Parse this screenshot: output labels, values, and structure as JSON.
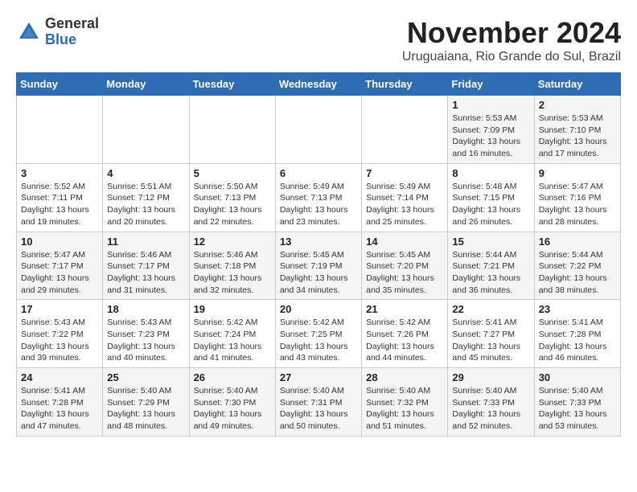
{
  "header": {
    "logo_general": "General",
    "logo_blue": "Blue",
    "month": "November 2024",
    "location": "Uruguaiana, Rio Grande do Sul, Brazil"
  },
  "weekdays": [
    "Sunday",
    "Monday",
    "Tuesday",
    "Wednesday",
    "Thursday",
    "Friday",
    "Saturday"
  ],
  "weeks": [
    [
      {
        "day": "",
        "info": ""
      },
      {
        "day": "",
        "info": ""
      },
      {
        "day": "",
        "info": ""
      },
      {
        "day": "",
        "info": ""
      },
      {
        "day": "",
        "info": ""
      },
      {
        "day": "1",
        "info": "Sunrise: 5:53 AM\nSunset: 7:09 PM\nDaylight: 13 hours and 16 minutes."
      },
      {
        "day": "2",
        "info": "Sunrise: 5:53 AM\nSunset: 7:10 PM\nDaylight: 13 hours and 17 minutes."
      }
    ],
    [
      {
        "day": "3",
        "info": "Sunrise: 5:52 AM\nSunset: 7:11 PM\nDaylight: 13 hours and 19 minutes."
      },
      {
        "day": "4",
        "info": "Sunrise: 5:51 AM\nSunset: 7:12 PM\nDaylight: 13 hours and 20 minutes."
      },
      {
        "day": "5",
        "info": "Sunrise: 5:50 AM\nSunset: 7:13 PM\nDaylight: 13 hours and 22 minutes."
      },
      {
        "day": "6",
        "info": "Sunrise: 5:49 AM\nSunset: 7:13 PM\nDaylight: 13 hours and 23 minutes."
      },
      {
        "day": "7",
        "info": "Sunrise: 5:49 AM\nSunset: 7:14 PM\nDaylight: 13 hours and 25 minutes."
      },
      {
        "day": "8",
        "info": "Sunrise: 5:48 AM\nSunset: 7:15 PM\nDaylight: 13 hours and 26 minutes."
      },
      {
        "day": "9",
        "info": "Sunrise: 5:47 AM\nSunset: 7:16 PM\nDaylight: 13 hours and 28 minutes."
      }
    ],
    [
      {
        "day": "10",
        "info": "Sunrise: 5:47 AM\nSunset: 7:17 PM\nDaylight: 13 hours and 29 minutes."
      },
      {
        "day": "11",
        "info": "Sunrise: 5:46 AM\nSunset: 7:17 PM\nDaylight: 13 hours and 31 minutes."
      },
      {
        "day": "12",
        "info": "Sunrise: 5:46 AM\nSunset: 7:18 PM\nDaylight: 13 hours and 32 minutes."
      },
      {
        "day": "13",
        "info": "Sunrise: 5:45 AM\nSunset: 7:19 PM\nDaylight: 13 hours and 34 minutes."
      },
      {
        "day": "14",
        "info": "Sunrise: 5:45 AM\nSunset: 7:20 PM\nDaylight: 13 hours and 35 minutes."
      },
      {
        "day": "15",
        "info": "Sunrise: 5:44 AM\nSunset: 7:21 PM\nDaylight: 13 hours and 36 minutes."
      },
      {
        "day": "16",
        "info": "Sunrise: 5:44 AM\nSunset: 7:22 PM\nDaylight: 13 hours and 38 minutes."
      }
    ],
    [
      {
        "day": "17",
        "info": "Sunrise: 5:43 AM\nSunset: 7:22 PM\nDaylight: 13 hours and 39 minutes."
      },
      {
        "day": "18",
        "info": "Sunrise: 5:43 AM\nSunset: 7:23 PM\nDaylight: 13 hours and 40 minutes."
      },
      {
        "day": "19",
        "info": "Sunrise: 5:42 AM\nSunset: 7:24 PM\nDaylight: 13 hours and 41 minutes."
      },
      {
        "day": "20",
        "info": "Sunrise: 5:42 AM\nSunset: 7:25 PM\nDaylight: 13 hours and 43 minutes."
      },
      {
        "day": "21",
        "info": "Sunrise: 5:42 AM\nSunset: 7:26 PM\nDaylight: 13 hours and 44 minutes."
      },
      {
        "day": "22",
        "info": "Sunrise: 5:41 AM\nSunset: 7:27 PM\nDaylight: 13 hours and 45 minutes."
      },
      {
        "day": "23",
        "info": "Sunrise: 5:41 AM\nSunset: 7:28 PM\nDaylight: 13 hours and 46 minutes."
      }
    ],
    [
      {
        "day": "24",
        "info": "Sunrise: 5:41 AM\nSunset: 7:28 PM\nDaylight: 13 hours and 47 minutes."
      },
      {
        "day": "25",
        "info": "Sunrise: 5:40 AM\nSunset: 7:29 PM\nDaylight: 13 hours and 48 minutes."
      },
      {
        "day": "26",
        "info": "Sunrise: 5:40 AM\nSunset: 7:30 PM\nDaylight: 13 hours and 49 minutes."
      },
      {
        "day": "27",
        "info": "Sunrise: 5:40 AM\nSunset: 7:31 PM\nDaylight: 13 hours and 50 minutes."
      },
      {
        "day": "28",
        "info": "Sunrise: 5:40 AM\nSunset: 7:32 PM\nDaylight: 13 hours and 51 minutes."
      },
      {
        "day": "29",
        "info": "Sunrise: 5:40 AM\nSunset: 7:33 PM\nDaylight: 13 hours and 52 minutes."
      },
      {
        "day": "30",
        "info": "Sunrise: 5:40 AM\nSunset: 7:33 PM\nDaylight: 13 hours and 53 minutes."
      }
    ]
  ]
}
